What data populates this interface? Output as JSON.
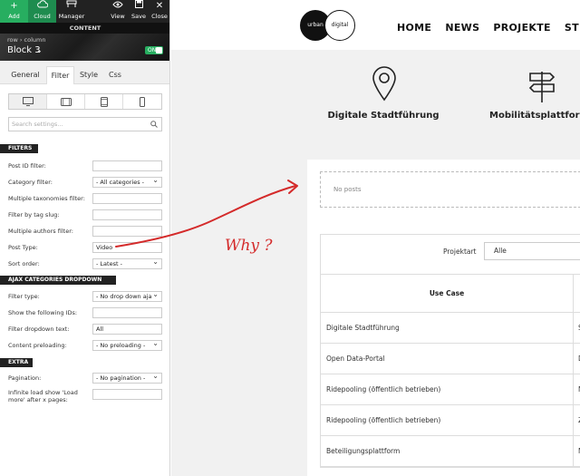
{
  "editor": {
    "toolbar": {
      "add": "Add",
      "cloud": "Cloud",
      "manager": "Manager",
      "view": "View",
      "save": "Save",
      "close": "Close"
    },
    "content_label": "CONTENT",
    "breadcrumb": "row › column",
    "block_title": "Block 3",
    "toggle_label": "ON",
    "tabs": [
      "General",
      "Filter",
      "Style",
      "Css"
    ],
    "active_tab": "Filter",
    "search_placeholder": "Search settings...",
    "sections": {
      "filters": "FILTERS",
      "ajax": "AJAX CATEGORIES DROPDOWN",
      "extra": "EXTRA"
    },
    "filters": [
      {
        "label": "Post ID filter:",
        "value": ""
      },
      {
        "label": "Category filter:",
        "value": "- All categories -"
      },
      {
        "label": "Multiple taxonomies filter:",
        "value": ""
      },
      {
        "label": "Filter by tag slug:",
        "value": ""
      },
      {
        "label": "Multiple authors filter:",
        "value": ""
      },
      {
        "label": "Post Type:",
        "value": "Video"
      },
      {
        "label": "Sort order:",
        "value": "- Latest -"
      }
    ],
    "ajax": [
      {
        "label": "Filter type:",
        "value": "- No drop down aja"
      },
      {
        "label": "Show the following IDs:",
        "value": ""
      },
      {
        "label": "Filter dropdown text:",
        "value": "All"
      },
      {
        "label": "Content preloading:",
        "value": "- No preloading -"
      }
    ],
    "extra": [
      {
        "label": "Pagination:",
        "value": "- No pagination -"
      },
      {
        "label": "Infinite load show 'Load more' after x pages:",
        "value": ""
      }
    ],
    "colors": {
      "accent": "#27ae60",
      "dark": "#222222"
    }
  },
  "site": {
    "logo_left": "urban",
    "logo_right": "digital",
    "nav": [
      "HOME",
      "NEWS",
      "PROJEKTE",
      "STRATEGIE"
    ],
    "features": [
      {
        "icon": "map-pin-icon",
        "title": "Digitale Stadtführung"
      },
      {
        "icon": "signpost-icon",
        "title": "Mobilitätsplattform"
      }
    ],
    "no_posts": "No posts",
    "table": {
      "filter_label": "Projektart",
      "filter_value": "Alle",
      "header": "Use Case",
      "rows": [
        {
          "use_case": "Digitale Stadtführung",
          "next": "S"
        },
        {
          "use_case": "Open Data-Portal",
          "next": "D"
        },
        {
          "use_case": "Ridepooling (öffentlich betrieben)",
          "next": "N"
        },
        {
          "use_case": "Ridepooling (öffentlich betrieben)",
          "next": "Z"
        },
        {
          "use_case": "Beteiligungsplattform",
          "next": "M"
        }
      ]
    }
  },
  "annotation": {
    "text": "Why ?",
    "color": "#d42a2a"
  }
}
